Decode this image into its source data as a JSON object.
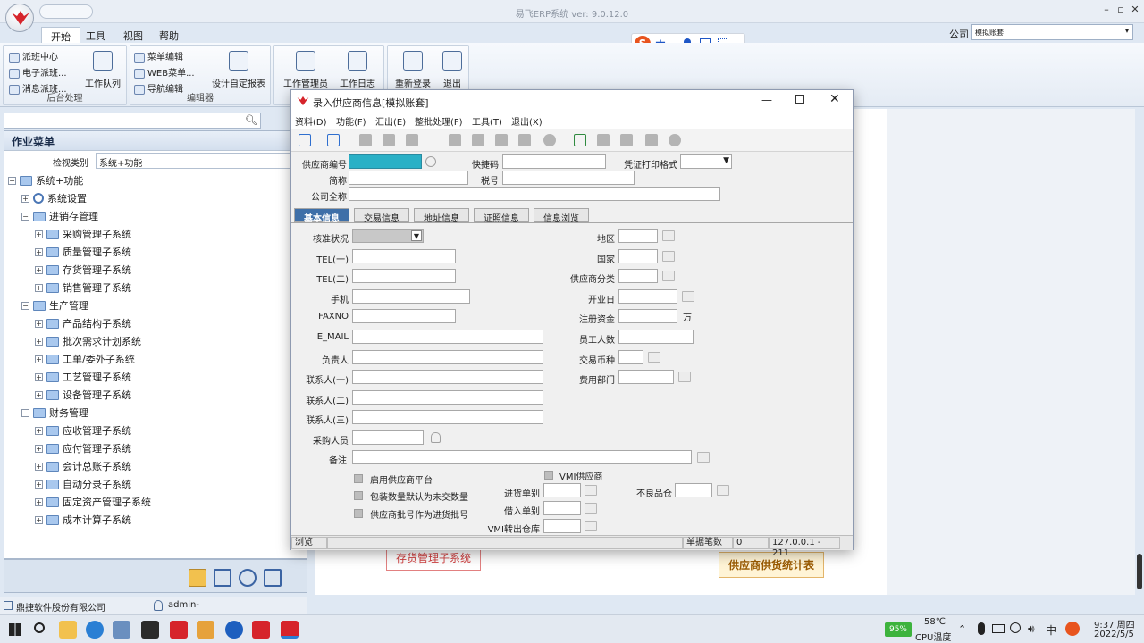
{
  "app": {
    "title": "易飞ERP系统 ver: 9.0.12.0",
    "company_label": "公司",
    "company_value": "模拟账套"
  },
  "ribbon": {
    "tabs": [
      "开始",
      "工具",
      "视图",
      "帮助"
    ],
    "groups": [
      {
        "label": "后台处理",
        "items": [
          "派班中心",
          "电子派班...",
          "消息派班..."
        ],
        "big": "工作队列"
      },
      {
        "label": "编辑器",
        "items": [
          "菜单编辑",
          "WEB菜单...",
          "导航编辑"
        ],
        "big": "设计自定报表"
      },
      {
        "big_items": [
          "工作管理员",
          "工作日志"
        ]
      },
      {
        "big_items": [
          "重新登录",
          "退出"
        ]
      }
    ]
  },
  "left_panel": {
    "title": "作业菜单",
    "view_label": "检视类别",
    "view_value": "系统+功能",
    "tree": [
      {
        "label": "系统+功能",
        "level": 0,
        "icon": "folder"
      },
      {
        "label": "系统设置",
        "level": 1,
        "icon": "gear"
      },
      {
        "label": "进销存管理",
        "level": 1,
        "icon": "truck"
      },
      {
        "label": "采购管理子系统",
        "level": 2,
        "icon": "folder"
      },
      {
        "label": "质量管理子系统",
        "level": 2,
        "icon": "folder"
      },
      {
        "label": "存货管理子系统",
        "level": 2,
        "icon": "folder"
      },
      {
        "label": "销售管理子系统",
        "level": 2,
        "icon": "folder"
      },
      {
        "label": "生产管理",
        "level": 1,
        "icon": "factory"
      },
      {
        "label": "产品结构子系统",
        "level": 2,
        "icon": "folder"
      },
      {
        "label": "批次需求计划系统",
        "level": 2,
        "icon": "folder"
      },
      {
        "label": "工单/委外子系统",
        "level": 2,
        "icon": "folder"
      },
      {
        "label": "工艺管理子系统",
        "level": 2,
        "icon": "folder"
      },
      {
        "label": "设备管理子系统",
        "level": 2,
        "icon": "folder"
      },
      {
        "label": "财务管理",
        "level": 1,
        "icon": "bank"
      },
      {
        "label": "应收管理子系统",
        "level": 2,
        "icon": "folder"
      },
      {
        "label": "应付管理子系统",
        "level": 2,
        "icon": "folder"
      },
      {
        "label": "会计总账子系统",
        "level": 2,
        "icon": "folder"
      },
      {
        "label": "自动分录子系统",
        "level": 2,
        "icon": "folder"
      },
      {
        "label": "固定资产管理子系统",
        "level": 2,
        "icon": "folder"
      },
      {
        "label": "成本计算子系统",
        "level": 2,
        "icon": "folder"
      }
    ]
  },
  "status_left": {
    "company": "鼎捷软件股份有限公司",
    "user": "admin-"
  },
  "background": {
    "flow1": "存货管理子系统",
    "flow2": "供应商供货统计表"
  },
  "dialog": {
    "title": "录入供应商信息[模拟账套]",
    "menu": [
      "资料(D)",
      "功能(F)",
      "汇出(E)",
      "整批处理(F)",
      "工具(T)",
      "退出(X)"
    ],
    "header_fields": {
      "supplier_no": "供应商编号",
      "quick_code": "快捷码",
      "voucher_format": "凭证打印格式",
      "short_name": "简称",
      "tax_no": "税号",
      "full_name": "公司全称"
    },
    "tabs": [
      "基本信息",
      "交易信息",
      "地址信息",
      "证照信息",
      "信息浏览"
    ],
    "left_fields": [
      "核准状况",
      "TEL(一)",
      "TEL(二)",
      "手机",
      "FAXNO",
      "E_MAIL",
      "负责人",
      "联系人(一)",
      "联系人(二)",
      "联系人(三)",
      "采购人员",
      "备注"
    ],
    "right_fields": [
      "地区",
      "国家",
      "供应商分类",
      "开业日",
      "注册资金",
      "员工人数",
      "交易币种",
      "费用部门"
    ],
    "capital_unit": "万",
    "checkboxes": [
      "启用供应商平台",
      "包装数量默认为未交数量",
      "供应商批号作为进货批号"
    ],
    "vmi_label": "VMI供应商",
    "bottom_fields": [
      "进货单别",
      "借入单别",
      "VMI转出仓库"
    ],
    "defect_label": "不良品仓",
    "status": {
      "mode": "浏览",
      "count_label": "单据笔数",
      "count_value": "0",
      "ip": "127.0.0.1 - 211"
    }
  },
  "taskbar": {
    "battery": "95%",
    "temp": "58℃",
    "temp_label": "CPU温度",
    "time": "9:37 周四",
    "date": "2022/5/5",
    "ime": "中"
  }
}
